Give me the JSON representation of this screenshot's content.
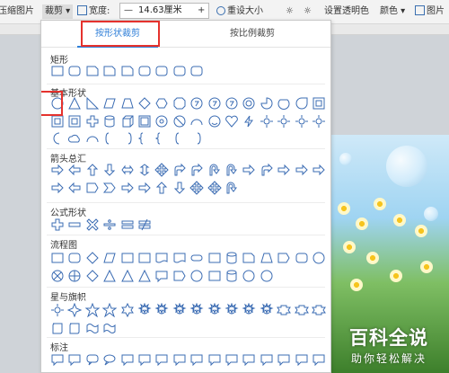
{
  "toolbar": {
    "compress_label": "压缩图片",
    "crop_label": "裁剪",
    "width_label": "宽度:",
    "width_value": "14.63厘米",
    "minus": "—",
    "plus": "+",
    "reset_label": "重设大小",
    "set_transparent_label": "设置透明色",
    "color_label": "颜色",
    "picture_label": "图片"
  },
  "crop_panel": {
    "tabs": [
      {
        "label": "按形状裁剪",
        "active": true
      },
      {
        "label": "按比例裁剪",
        "active": false
      }
    ],
    "sections": [
      {
        "title": "矩形"
      },
      {
        "title": "基本形状"
      },
      {
        "title": "箭头总汇"
      },
      {
        "title": "公式形状"
      },
      {
        "title": "流程图"
      },
      {
        "title": "星与旗帜"
      },
      {
        "title": "标注"
      }
    ],
    "accent_color": "#2f7fd8",
    "highlight_color": "#e5322d",
    "shape_color": "#3b6cb3"
  },
  "watermark": {
    "main": "百科全说",
    "sub": "助你轻松解决"
  }
}
